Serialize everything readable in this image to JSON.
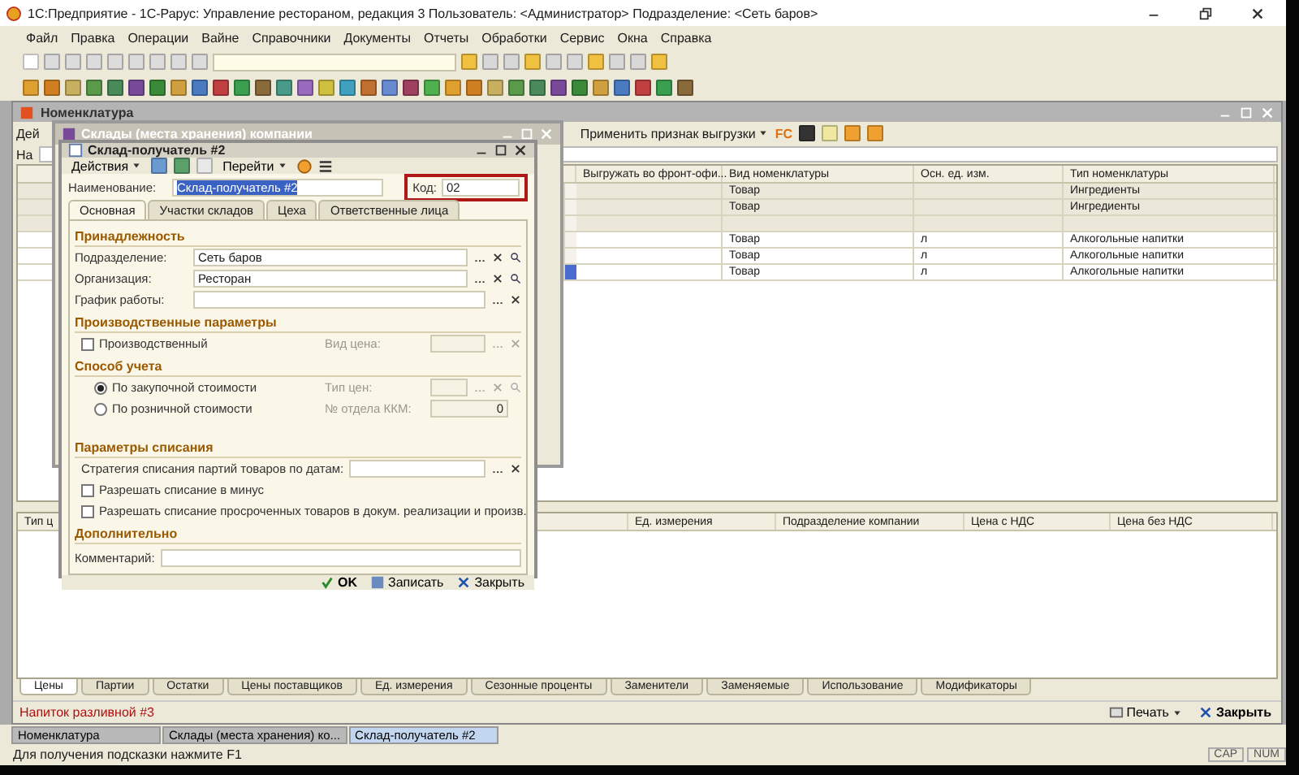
{
  "app_window": {
    "title": "1С:Предприятие - 1С-Рарус: Управление рестораном, редакция 3   Пользователь: <Администратор>   Подразделение: <Сеть баров>",
    "menu": [
      "Файл",
      "Правка",
      "Операции",
      "Вайне",
      "Справочники",
      "Документы",
      "Отчеты",
      "Обработки",
      "Сервис",
      "Окна",
      "Справка"
    ]
  },
  "nomenclature_window": {
    "title": "Номенклатура",
    "actions_fragment": "Дей",
    "apply_button": "Применить признак выгрузки",
    "fc_label": "FC",
    "filter_fragment": "На",
    "table": {
      "columns": [
        "Выгружать во фронт-офи...",
        "Вид номенклатуры",
        "Осн. ед. изм.",
        "Тип номенклатуры"
      ],
      "rows": [
        {
          "kind": "group",
          "selected": false,
          "cells": [
            "",
            "Товар",
            "",
            "Ингредиенты"
          ]
        },
        {
          "kind": "group",
          "selected": false,
          "cells": [
            "",
            "Товар",
            "",
            "Ингредиенты"
          ]
        },
        {
          "kind": "group",
          "selected": false,
          "cells": [
            "",
            "",
            "",
            ""
          ]
        },
        {
          "kind": "item",
          "selected": false,
          "cells": [
            "",
            "Товар",
            "л",
            "Алкогольные напитки"
          ]
        },
        {
          "kind": "item",
          "selected": false,
          "cells": [
            "",
            "Товар",
            "л",
            "Алкогольные напитки"
          ]
        },
        {
          "kind": "item",
          "selected": true,
          "cells": [
            "",
            "Товар",
            "л",
            "Алкогольные напитки"
          ]
        }
      ]
    },
    "lower_table": {
      "columns": [
        "Тип ц",
        "Ед. измерения",
        "Подразделение компании",
        "Цена с НДС",
        "Цена без НДС"
      ]
    },
    "tabs": [
      {
        "label": "Цены",
        "selected": true
      },
      {
        "label": "Партии",
        "selected": false
      },
      {
        "label": "Остатки",
        "selected": false
      },
      {
        "label": "Цены поставщиков",
        "selected": false
      },
      {
        "label": "Ед. измерения",
        "selected": false
      },
      {
        "label": "Сезонные проценты",
        "selected": false
      },
      {
        "label": "Заменители",
        "selected": false
      },
      {
        "label": "Заменяемые",
        "selected": false
      },
      {
        "label": "Использование",
        "selected": false
      },
      {
        "label": "Модификаторы",
        "selected": false
      }
    ],
    "item_name": "Напиток разливной #3",
    "print_button": "Печать",
    "close_button": "Закрыть"
  },
  "warehouses_window": {
    "title": "Склады (места хранения) компании"
  },
  "dialog": {
    "title": "Склад-получатель #2",
    "actions_menu": "Действия",
    "goto_menu": "Перейти",
    "name_label": "Наименование:",
    "name_value": "Склад-получатель #2",
    "code_label": "Код:",
    "code_value": "02",
    "tabs": [
      {
        "label": "Основная",
        "selected": true
      },
      {
        "label": "Участки складов",
        "selected": false
      },
      {
        "label": "Цеха",
        "selected": false
      },
      {
        "label": "Ответственные лица",
        "selected": false
      }
    ],
    "sections": [
      {
        "title": "Принадлежность",
        "rows": [
          {
            "kind": "field",
            "label": "Подразделение:",
            "value": "Сеть баров",
            "search": true
          },
          {
            "kind": "field",
            "label": "Организация:",
            "value": "Ресторан",
            "search": true
          },
          {
            "kind": "field",
            "label": "График работы:",
            "search": false
          }
        ]
      },
      {
        "title": "Производственные параметры",
        "rows": [
          {
            "kind": "check",
            "label": "Производственный",
            "checked": false,
            "side": {
              "label": "Вид цена:",
              "disabled": true,
              "search": false,
              "number": false
            }
          }
        ]
      },
      {
        "title": "Способ учета",
        "rows": [
          {
            "kind": "radio",
            "label": "По закупочной стоимости",
            "selected": true,
            "side": {
              "label": "Тип цен:",
              "disabled": true,
              "search": true,
              "number": false
            }
          },
          {
            "kind": "radio",
            "label": "По розничной стоимости",
            "selected": false,
            "side": {
              "label": "№ отдела ККМ:",
              "value": "0",
              "disabled": true,
              "number": true
            }
          }
        ]
      },
      {
        "title": "Параметры списания",
        "rows": [
          {
            "kind": "wide_field",
            "label": "Стратегия списания партий товаров по датам:"
          },
          {
            "kind": "check",
            "label": "Разрешать списание в минус",
            "checked": false
          },
          {
            "kind": "check",
            "label": "Разрешать списание просроченных товаров в докум. реализации и произв.",
            "checked": false
          }
        ]
      },
      {
        "title": "Дополнительно",
        "rows": [
          {
            "kind": "comment",
            "label": "Комментарий:"
          }
        ]
      }
    ],
    "ok_button": "OK",
    "save_button": "Записать",
    "close_button": "Закрыть"
  },
  "window_list": [
    {
      "label": "Номенклатура",
      "selected": false
    },
    {
      "label": "Склады (места хранения) ко...",
      "selected": false
    },
    {
      "label": "Склад-получатель #2",
      "selected": true
    }
  ],
  "status_bar": {
    "hint": "Для получения подсказки нажмите F1",
    "indicators": [
      "CAP",
      "NUM"
    ]
  }
}
